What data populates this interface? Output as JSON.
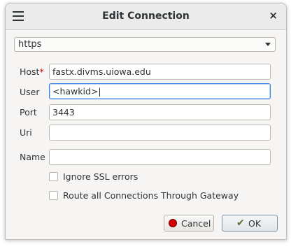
{
  "window": {
    "title": "Edit Connection",
    "close_glyph": "×"
  },
  "protocol": {
    "selected": "https"
  },
  "form": {
    "host_label": "Host",
    "host_required_marker": "*",
    "host_value": "fastx.divms.uiowa.edu",
    "user_label": "User",
    "user_value": "<hawkid>|",
    "port_label": "Port",
    "port_value": "3443",
    "uri_label": "Uri",
    "uri_value": "",
    "name_label": "Name",
    "name_value": ""
  },
  "options": {
    "ignore_ssl": "Ignore SSL errors",
    "route_gateway": "Route all Connections Through Gateway"
  },
  "buttons": {
    "cancel_label": "Cancel",
    "ok_label": "OK"
  },
  "icons": {
    "menu": "hamburger-menu-icon",
    "close": "close-icon",
    "cancel": "cancel-red-dot-icon",
    "ok": "ok-check-icon"
  }
}
